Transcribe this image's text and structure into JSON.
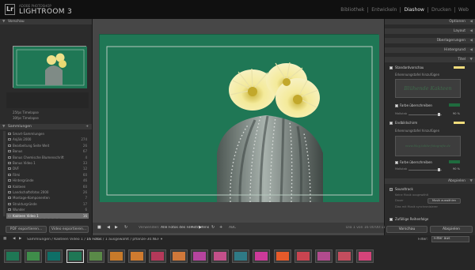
{
  "app": {
    "logo": "Lr",
    "brand_sub": "ADOBE PHOTOSHOP",
    "brand_main": "LIGHTROOM 3"
  },
  "modules": [
    {
      "label": "Bibliothek"
    },
    {
      "label": "Entwickeln"
    },
    {
      "label": "Diashow",
      "active": true
    },
    {
      "label": "Drucken"
    },
    {
      "label": "Web"
    }
  ],
  "left": {
    "preview_header": "Vorschau",
    "templates": [
      "25fps Timelapse",
      "30fps Timelapse"
    ],
    "collections_header": "Sammlungen",
    "collections": [
      {
        "name": "Smart-Sammlungen",
        "count": ""
      },
      {
        "name": "Anjäls 2000",
        "count": "274"
      },
      {
        "name": "Bearbeitung Seite Weit",
        "count": "26"
      },
      {
        "name": "Bonus",
        "count": "67"
      },
      {
        "name": "Bonus Chemische Blumenschrift",
        "count": "4"
      },
      {
        "name": "Bonus Video 1",
        "count": "33"
      },
      {
        "name": "DVF",
        "count": "12"
      },
      {
        "name": "Filmi",
        "count": "60"
      },
      {
        "name": "Hintergründe",
        "count": "46"
      },
      {
        "name": "Kakteen",
        "count": "60"
      },
      {
        "name": "Landschaftsfotos 2000",
        "count": "26"
      },
      {
        "name": "Montage-Komponenten",
        "count": "7"
      },
      {
        "name": "Strukturgründe",
        "count": "17"
      },
      {
        "name": "Wunder",
        "count": "6"
      },
      {
        "name": "Kakteen Video 1",
        "count": "16",
        "selected": true
      }
    ],
    "pdf_button": "PDF exportieren...",
    "video_button": "Video exportieren..."
  },
  "toolbar": {
    "use_label": "Verwenden:",
    "use_value": "Alle Fotos des Filmstreifens",
    "use_arrow": "÷",
    "slide_info": "Dia 1 von 16  00:00:11",
    "abc": "ABC"
  },
  "right": {
    "sections": [
      "Optionen",
      "Layout",
      "Überlagerungen",
      "Hintergrund",
      "Titel"
    ],
    "intro": "Standardvorschau",
    "add_id": "Erkennungstafel hinzufügen",
    "intro_text": "Blühende Kakteen",
    "color_override": "Farbe überschreiben",
    "scale_label": "Maßstab",
    "scale_value": "90 %",
    "outro": "Endbildschirm",
    "outro_add": "Erkennungstafel hinzufügen",
    "outro_text": "www.blog.tobbe-fotografie.de",
    "outro_color": "Farbe überschreiben",
    "outro_scale_label": "Maßstab",
    "outro_scale_value": "90 %",
    "playback_header": "Abspielen",
    "soundtrack": "Soundtrack",
    "soundtrack_sub": "Keine Musik ausgewählt",
    "music_btn": "Musik auswählen",
    "duration": "Dauer",
    "duration_sub": "Dias mit Musik synchronisieren",
    "order": "Zufällige Reihenfolge",
    "preview_btn": "Vorschau",
    "play_btn": "Abspielen",
    "swatch_color": "#f1dc7b"
  },
  "filmbar": {
    "nav": "Sammlungen / Kakteen Video 1 / ",
    "count": "16 Fotos",
    "selection": " / 1 ausgewählt / pflanze-30.NEF ▾",
    "filter_label": "Filter:",
    "filter_value": "Filter aus"
  },
  "thumbs": [
    {
      "color": "#1f7755"
    },
    {
      "color": "#3f8d4a"
    },
    {
      "color": "#0e6f67"
    },
    {
      "color": "#1f7755",
      "selected": true
    },
    {
      "color": "#5a8a48"
    },
    {
      "color": "#c77a2a"
    },
    {
      "color": "#cf7b2f"
    },
    {
      "color": "#b5395a"
    },
    {
      "color": "#d0783a"
    },
    {
      "color": "#b5449e"
    },
    {
      "color": "#c2508a"
    },
    {
      "color": "#2f7a86"
    },
    {
      "color": "#cc3a99"
    },
    {
      "color": "#e65a2a"
    },
    {
      "color": "#c84450"
    },
    {
      "color": "#b24b8e"
    },
    {
      "color": "#c34d5e"
    },
    {
      "color": "#d4447a"
    }
  ]
}
